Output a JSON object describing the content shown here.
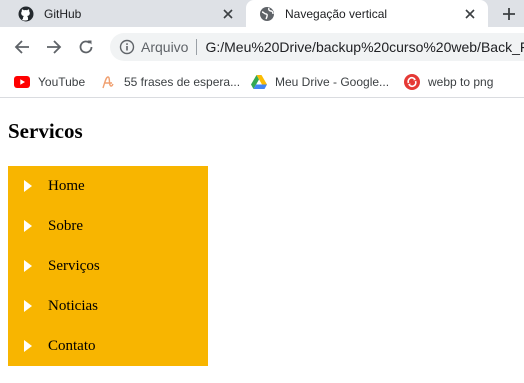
{
  "tabs": [
    {
      "title": "GitHub",
      "icon": "github-icon",
      "active": false
    },
    {
      "title": "Navegação vertical",
      "icon": "globe-icon",
      "active": true
    }
  ],
  "omnibox": {
    "scheme_label": "Arquivo",
    "url": "G:/Meu%20Drive/backup%20curso%20web/Back_Fr"
  },
  "bookmarks": [
    {
      "label": "YouTube",
      "icon": "youtube-icon"
    },
    {
      "label": "55 frases de espera...",
      "icon": "script-icon"
    },
    {
      "label": "Meu Drive - Google...",
      "icon": "google-drive-icon"
    },
    {
      "label": "webp to png",
      "icon": "converter-icon"
    }
  ],
  "page": {
    "heading": "Servicos",
    "nav_items": [
      "Home",
      "Sobre",
      "Serviços",
      "Noticias",
      "Contato"
    ]
  },
  "colors": {
    "nav_background": "#f8b500",
    "nav_arrow": "#ffffff",
    "tabstrip": "#dee1e6",
    "omnibox": "#f1f3f4"
  }
}
